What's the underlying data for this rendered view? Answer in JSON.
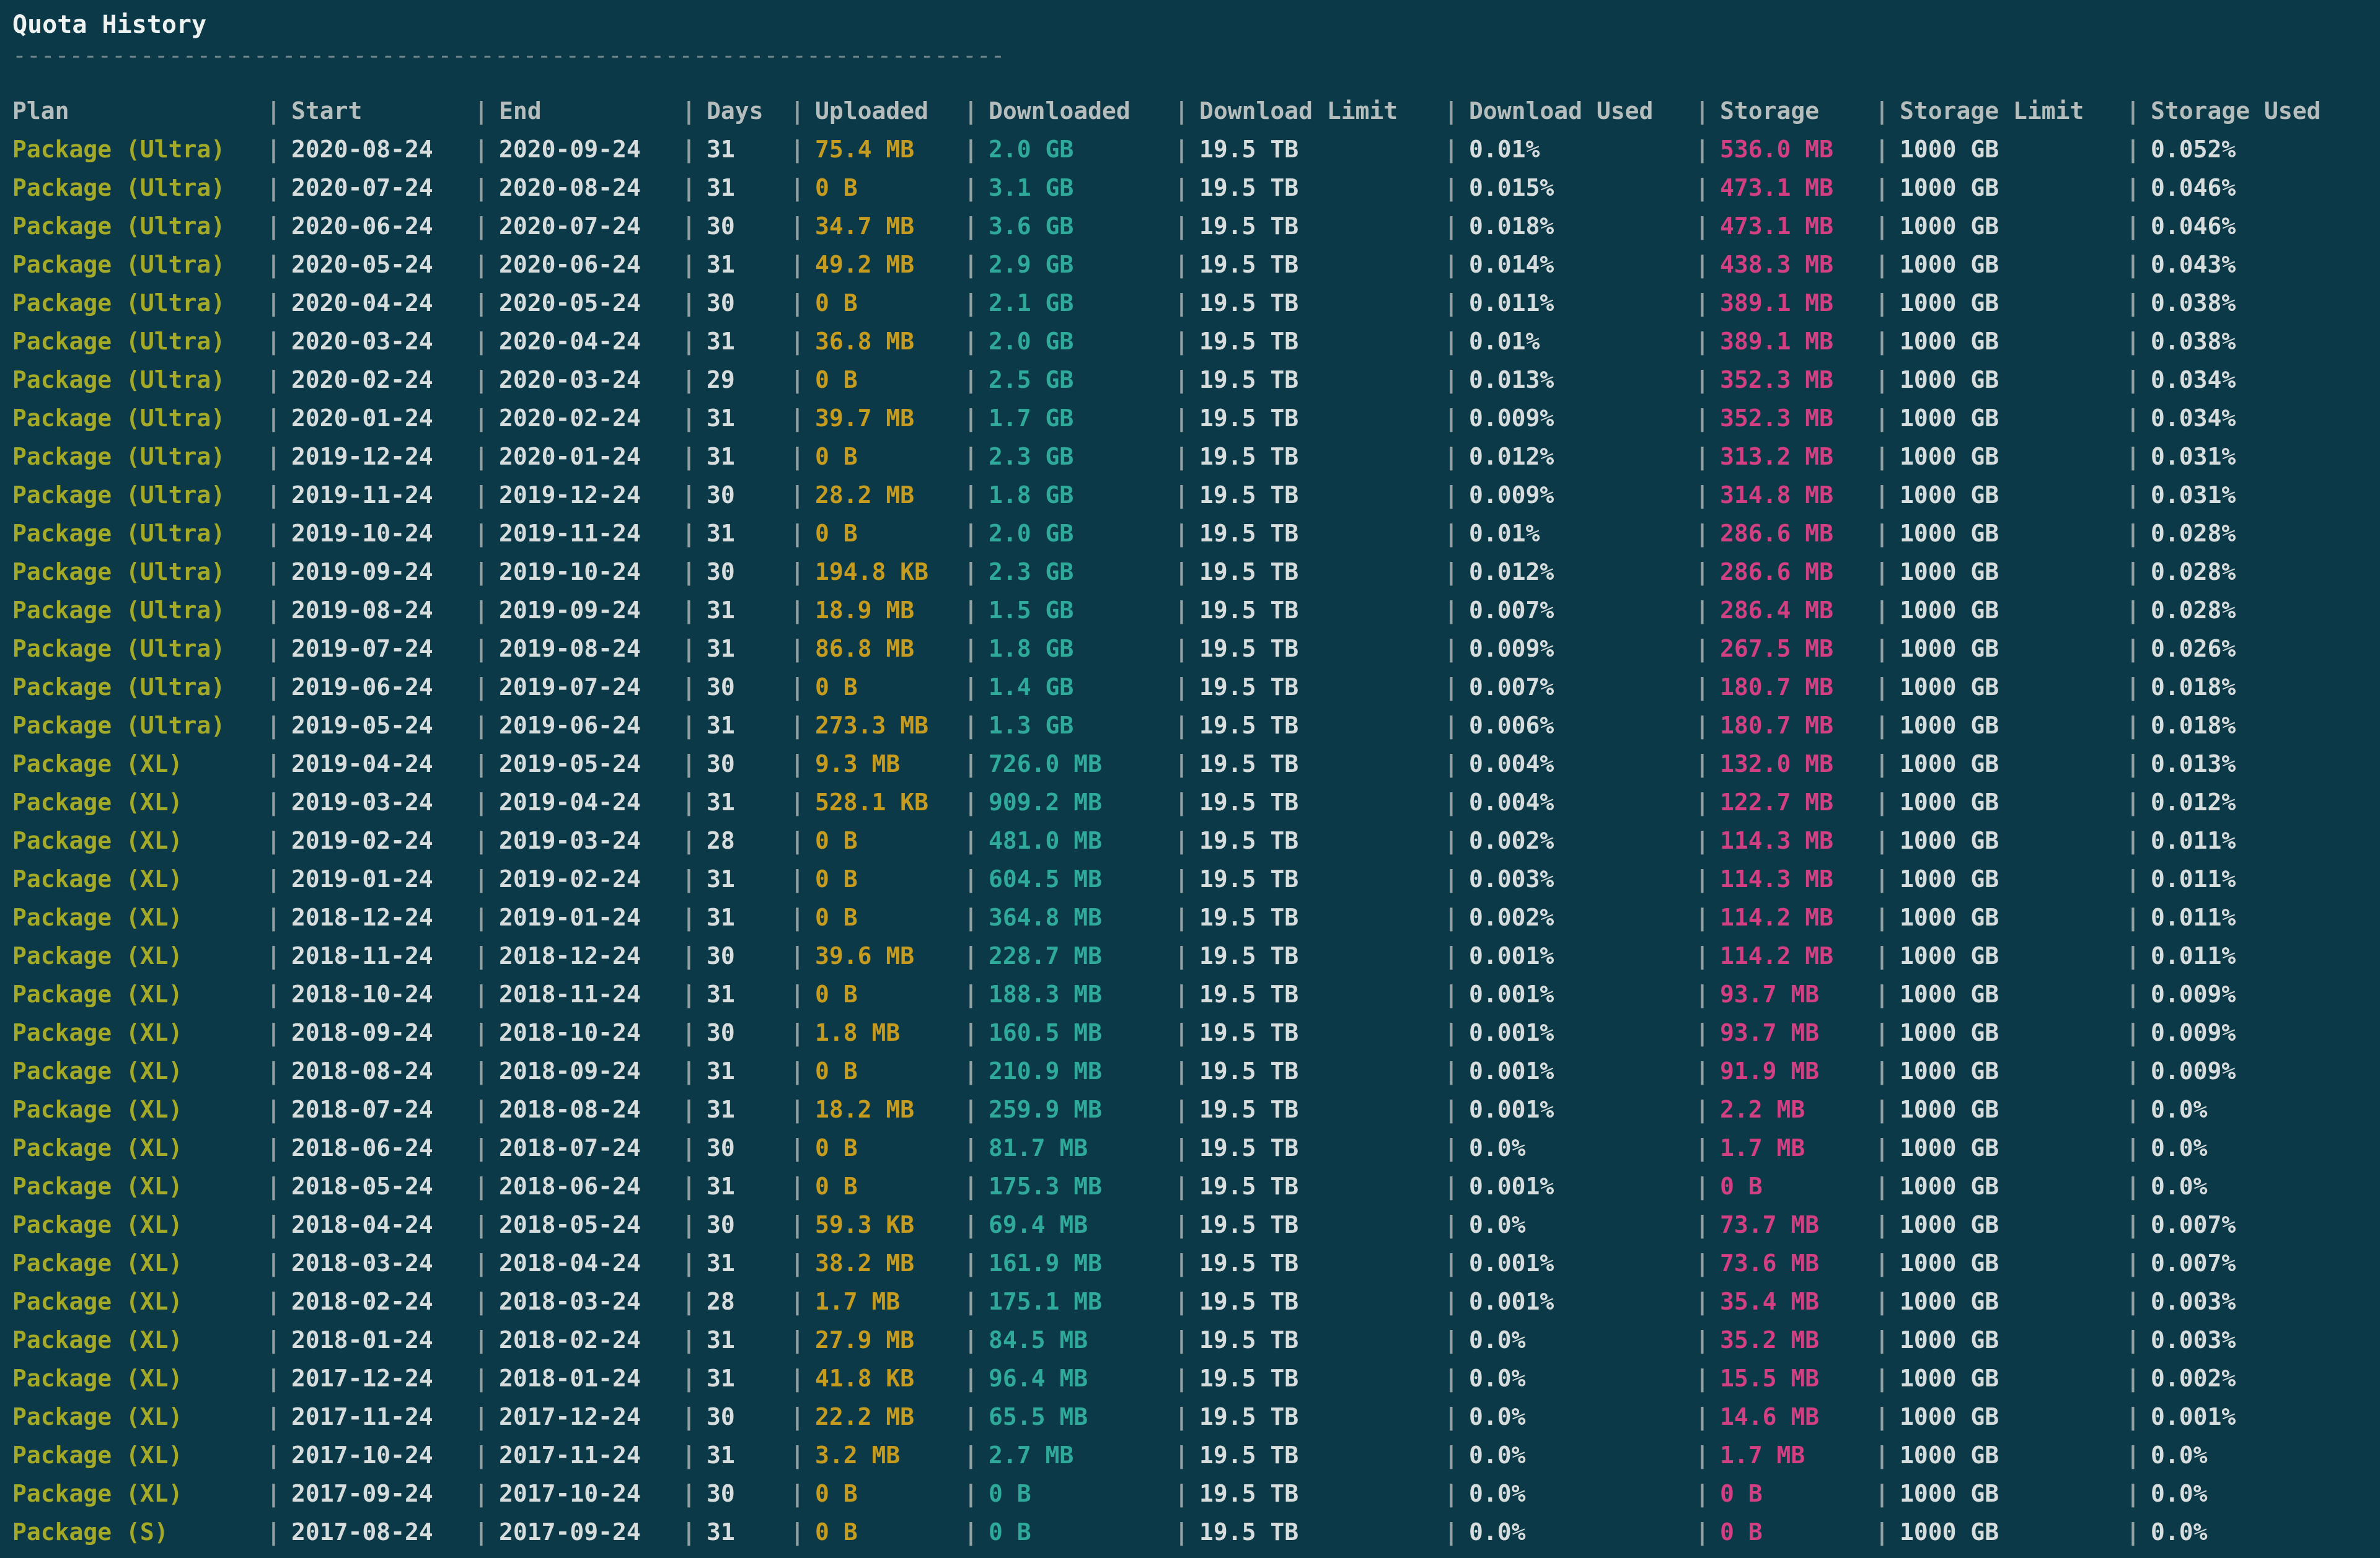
{
  "title": "Quota History",
  "separator": "----------------------------------------------------------------------",
  "columns": [
    "Plan",
    "Start",
    "End",
    "Days",
    "Uploaded",
    "Downloaded",
    "Download Limit",
    "Download Used",
    "Storage",
    "Storage Limit",
    "Storage Used"
  ],
  "rows": [
    [
      "Package (Ultra)",
      "2020-08-24",
      "2020-09-24",
      "31",
      "75.4 MB",
      "2.0 GB",
      "19.5 TB",
      "0.01%",
      "536.0 MB",
      "1000 GB",
      "0.052%"
    ],
    [
      "Package (Ultra)",
      "2020-07-24",
      "2020-08-24",
      "31",
      "0 B",
      "3.1 GB",
      "19.5 TB",
      "0.015%",
      "473.1 MB",
      "1000 GB",
      "0.046%"
    ],
    [
      "Package (Ultra)",
      "2020-06-24",
      "2020-07-24",
      "30",
      "34.7 MB",
      "3.6 GB",
      "19.5 TB",
      "0.018%",
      "473.1 MB",
      "1000 GB",
      "0.046%"
    ],
    [
      "Package (Ultra)",
      "2020-05-24",
      "2020-06-24",
      "31",
      "49.2 MB",
      "2.9 GB",
      "19.5 TB",
      "0.014%",
      "438.3 MB",
      "1000 GB",
      "0.043%"
    ],
    [
      "Package (Ultra)",
      "2020-04-24",
      "2020-05-24",
      "30",
      "0 B",
      "2.1 GB",
      "19.5 TB",
      "0.011%",
      "389.1 MB",
      "1000 GB",
      "0.038%"
    ],
    [
      "Package (Ultra)",
      "2020-03-24",
      "2020-04-24",
      "31",
      "36.8 MB",
      "2.0 GB",
      "19.5 TB",
      "0.01%",
      "389.1 MB",
      "1000 GB",
      "0.038%"
    ],
    [
      "Package (Ultra)",
      "2020-02-24",
      "2020-03-24",
      "29",
      "0 B",
      "2.5 GB",
      "19.5 TB",
      "0.013%",
      "352.3 MB",
      "1000 GB",
      "0.034%"
    ],
    [
      "Package (Ultra)",
      "2020-01-24",
      "2020-02-24",
      "31",
      "39.7 MB",
      "1.7 GB",
      "19.5 TB",
      "0.009%",
      "352.3 MB",
      "1000 GB",
      "0.034%"
    ],
    [
      "Package (Ultra)",
      "2019-12-24",
      "2020-01-24",
      "31",
      "0 B",
      "2.3 GB",
      "19.5 TB",
      "0.012%",
      "313.2 MB",
      "1000 GB",
      "0.031%"
    ],
    [
      "Package (Ultra)",
      "2019-11-24",
      "2019-12-24",
      "30",
      "28.2 MB",
      "1.8 GB",
      "19.5 TB",
      "0.009%",
      "314.8 MB",
      "1000 GB",
      "0.031%"
    ],
    [
      "Package (Ultra)",
      "2019-10-24",
      "2019-11-24",
      "31",
      "0 B",
      "2.0 GB",
      "19.5 TB",
      "0.01%",
      "286.6 MB",
      "1000 GB",
      "0.028%"
    ],
    [
      "Package (Ultra)",
      "2019-09-24",
      "2019-10-24",
      "30",
      "194.8 KB",
      "2.3 GB",
      "19.5 TB",
      "0.012%",
      "286.6 MB",
      "1000 GB",
      "0.028%"
    ],
    [
      "Package (Ultra)",
      "2019-08-24",
      "2019-09-24",
      "31",
      "18.9 MB",
      "1.5 GB",
      "19.5 TB",
      "0.007%",
      "286.4 MB",
      "1000 GB",
      "0.028%"
    ],
    [
      "Package (Ultra)",
      "2019-07-24",
      "2019-08-24",
      "31",
      "86.8 MB",
      "1.8 GB",
      "19.5 TB",
      "0.009%",
      "267.5 MB",
      "1000 GB",
      "0.026%"
    ],
    [
      "Package (Ultra)",
      "2019-06-24",
      "2019-07-24",
      "30",
      "0 B",
      "1.4 GB",
      "19.5 TB",
      "0.007%",
      "180.7 MB",
      "1000 GB",
      "0.018%"
    ],
    [
      "Package (Ultra)",
      "2019-05-24",
      "2019-06-24",
      "31",
      "273.3 MB",
      "1.3 GB",
      "19.5 TB",
      "0.006%",
      "180.7 MB",
      "1000 GB",
      "0.018%"
    ],
    [
      "Package (XL)",
      "2019-04-24",
      "2019-05-24",
      "30",
      "9.3 MB",
      "726.0 MB",
      "19.5 TB",
      "0.004%",
      "132.0 MB",
      "1000 GB",
      "0.013%"
    ],
    [
      "Package (XL)",
      "2019-03-24",
      "2019-04-24",
      "31",
      "528.1 KB",
      "909.2 MB",
      "19.5 TB",
      "0.004%",
      "122.7 MB",
      "1000 GB",
      "0.012%"
    ],
    [
      "Package (XL)",
      "2019-02-24",
      "2019-03-24",
      "28",
      "0 B",
      "481.0 MB",
      "19.5 TB",
      "0.002%",
      "114.3 MB",
      "1000 GB",
      "0.011%"
    ],
    [
      "Package (XL)",
      "2019-01-24",
      "2019-02-24",
      "31",
      "0 B",
      "604.5 MB",
      "19.5 TB",
      "0.003%",
      "114.3 MB",
      "1000 GB",
      "0.011%"
    ],
    [
      "Package (XL)",
      "2018-12-24",
      "2019-01-24",
      "31",
      "0 B",
      "364.8 MB",
      "19.5 TB",
      "0.002%",
      "114.2 MB",
      "1000 GB",
      "0.011%"
    ],
    [
      "Package (XL)",
      "2018-11-24",
      "2018-12-24",
      "30",
      "39.6 MB",
      "228.7 MB",
      "19.5 TB",
      "0.001%",
      "114.2 MB",
      "1000 GB",
      "0.011%"
    ],
    [
      "Package (XL)",
      "2018-10-24",
      "2018-11-24",
      "31",
      "0 B",
      "188.3 MB",
      "19.5 TB",
      "0.001%",
      "93.7 MB",
      "1000 GB",
      "0.009%"
    ],
    [
      "Package (XL)",
      "2018-09-24",
      "2018-10-24",
      "30",
      "1.8 MB",
      "160.5 MB",
      "19.5 TB",
      "0.001%",
      "93.7 MB",
      "1000 GB",
      "0.009%"
    ],
    [
      "Package (XL)",
      "2018-08-24",
      "2018-09-24",
      "31",
      "0 B",
      "210.9 MB",
      "19.5 TB",
      "0.001%",
      "91.9 MB",
      "1000 GB",
      "0.009%"
    ],
    [
      "Package (XL)",
      "2018-07-24",
      "2018-08-24",
      "31",
      "18.2 MB",
      "259.9 MB",
      "19.5 TB",
      "0.001%",
      "2.2 MB",
      "1000 GB",
      "0.0%"
    ],
    [
      "Package (XL)",
      "2018-06-24",
      "2018-07-24",
      "30",
      "0 B",
      "81.7 MB",
      "19.5 TB",
      "0.0%",
      "1.7 MB",
      "1000 GB",
      "0.0%"
    ],
    [
      "Package (XL)",
      "2018-05-24",
      "2018-06-24",
      "31",
      "0 B",
      "175.3 MB",
      "19.5 TB",
      "0.001%",
      "0 B",
      "1000 GB",
      "0.0%"
    ],
    [
      "Package (XL)",
      "2018-04-24",
      "2018-05-24",
      "30",
      "59.3 KB",
      "69.4 MB",
      "19.5 TB",
      "0.0%",
      "73.7 MB",
      "1000 GB",
      "0.007%"
    ],
    [
      "Package (XL)",
      "2018-03-24",
      "2018-04-24",
      "31",
      "38.2 MB",
      "161.9 MB",
      "19.5 TB",
      "0.001%",
      "73.6 MB",
      "1000 GB",
      "0.007%"
    ],
    [
      "Package (XL)",
      "2018-02-24",
      "2018-03-24",
      "28",
      "1.7 MB",
      "175.1 MB",
      "19.5 TB",
      "0.001%",
      "35.4 MB",
      "1000 GB",
      "0.003%"
    ],
    [
      "Package (XL)",
      "2018-01-24",
      "2018-02-24",
      "31",
      "27.9 MB",
      "84.5 MB",
      "19.5 TB",
      "0.0%",
      "35.2 MB",
      "1000 GB",
      "0.003%"
    ],
    [
      "Package (XL)",
      "2017-12-24",
      "2018-01-24",
      "31",
      "41.8 KB",
      "96.4 MB",
      "19.5 TB",
      "0.0%",
      "15.5 MB",
      "1000 GB",
      "0.002%"
    ],
    [
      "Package (XL)",
      "2017-11-24",
      "2017-12-24",
      "30",
      "22.2 MB",
      "65.5 MB",
      "19.5 TB",
      "0.0%",
      "14.6 MB",
      "1000 GB",
      "0.001%"
    ],
    [
      "Package (XL)",
      "2017-10-24",
      "2017-11-24",
      "31",
      "3.2 MB",
      "2.7 MB",
      "19.5 TB",
      "0.0%",
      "1.7 MB",
      "1000 GB",
      "0.0%"
    ],
    [
      "Package (XL)",
      "2017-09-24",
      "2017-10-24",
      "30",
      "0 B",
      "0 B",
      "19.5 TB",
      "0.0%",
      "0 B",
      "1000 GB",
      "0.0%"
    ],
    [
      "Package (S)",
      "2017-08-24",
      "2017-09-24",
      "31",
      "0 B",
      "0 B",
      "19.5 TB",
      "0.0%",
      "0 B",
      "1000 GB",
      "0.0%"
    ]
  ]
}
